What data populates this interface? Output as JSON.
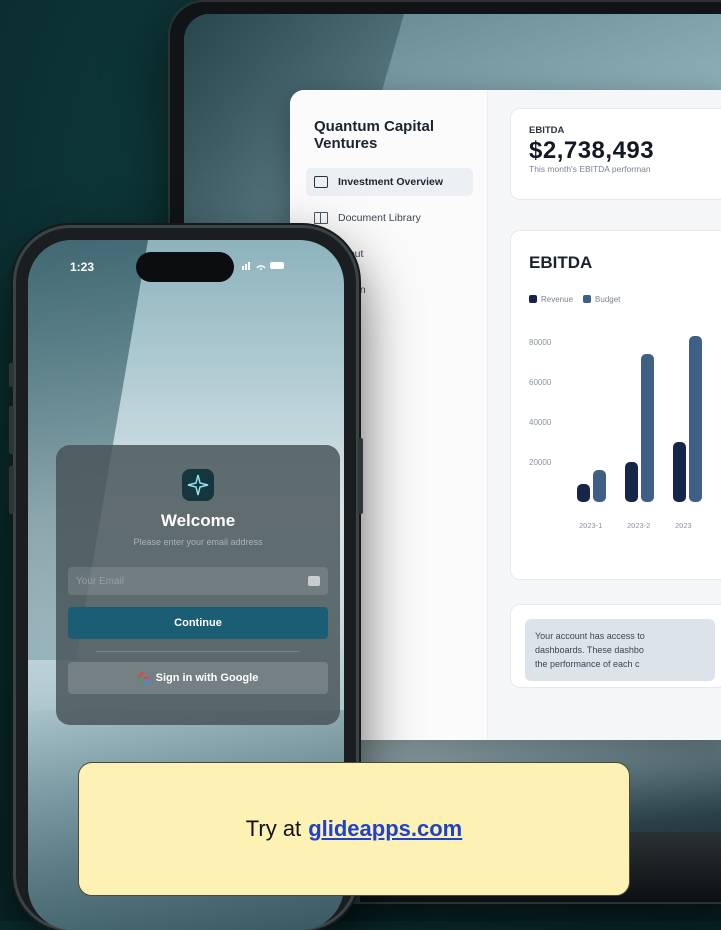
{
  "colors": {
    "revenue": "#16264a",
    "budget": "#3f5f85",
    "continue_button": "#1b5d74",
    "cta_background": "#fef1b4",
    "cta_link": "#1f42c8"
  },
  "dashboard": {
    "app_title": "Quantum Capital Ventures",
    "nav": [
      {
        "label": "Investment Overview",
        "icon": "edit-icon",
        "active": true
      },
      {
        "label": "Document Library",
        "icon": "book-icon",
        "active": false
      },
      {
        "label": "About",
        "icon": "info-icon",
        "active": false
      },
      {
        "label": "Admin",
        "icon": "user-icon",
        "active": false
      }
    ],
    "kpi": {
      "label": "EBITDA",
      "value": "$2,738,493",
      "sub": "This month's EBITDA performan"
    },
    "chart_title": "EBITDA",
    "notice_lines": [
      "Your account has access to",
      "dashboards. These dashbo",
      "the performance of each c"
    ]
  },
  "chart_data": {
    "type": "bar",
    "title": "EBITDA",
    "categories": [
      "2023-1",
      "2023-2",
      "2023"
    ],
    "series": [
      {
        "name": "Revenue",
        "values": [
          9000,
          20000,
          30000
        ]
      },
      {
        "name": "Budget",
        "values": [
          16000,
          74000,
          83000
        ]
      }
    ],
    "yticks": [
      20000,
      40000,
      60000,
      80000
    ],
    "ylim": [
      0,
      90000
    ],
    "legend": "top-left",
    "grid": false
  },
  "phone": {
    "time": "1:23",
    "status_icons": "signal-wifi-battery",
    "login": {
      "title": "Welcome",
      "subtitle": "Please enter your email address",
      "email_placeholder": "Your Email",
      "continue_label": "Continue",
      "google_label": "Sign in with Google"
    }
  },
  "cta": {
    "text": "Try at",
    "link": "glideapps.com"
  }
}
